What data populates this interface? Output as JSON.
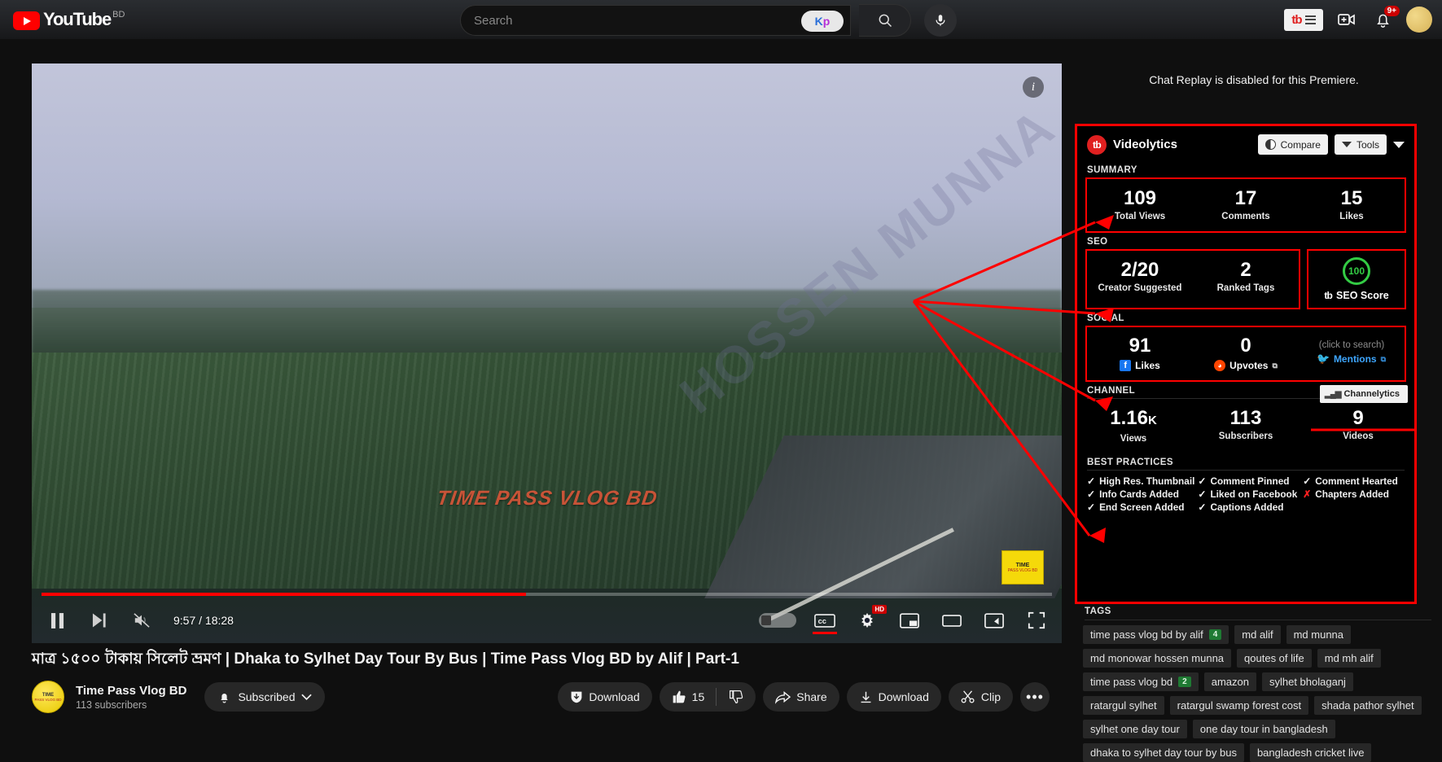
{
  "masthead": {
    "logo_text": "YouTube",
    "country_code": "BD",
    "search_placeholder": "Search",
    "search_value": "",
    "kp_badge_k": "K",
    "kp_badge_p": "p",
    "tubebuddy_label": "tb",
    "notification_count": "9+"
  },
  "player": {
    "current_time": "9:57",
    "duration": "18:28",
    "time_display": "9:57 / 18:28",
    "progress_percent": 47,
    "watermark_diagonal": "HOSSEN MUNNA",
    "watermark_center": "TIME PASS VLOG BD",
    "corner_logo_line1": "TIME",
    "corner_logo_line2": "PASS VLOG BD",
    "cc_label": "CC",
    "hd_badge": "HD",
    "info_glyph": "i"
  },
  "video": {
    "title": "মাত্র ১৫০০ টাকায় সিলেট ভ্রমণ | Dhaka to Sylhet Day Tour By Bus | Time Pass Vlog BD by Alif | Part-1",
    "channel_name": "Time Pass Vlog BD",
    "channel_subs": "113 subscribers",
    "avatar_line1": "TIME",
    "avatar_line2": "PASS VLOG BD",
    "subscribed_label": "Subscribed",
    "download_primary_label": "Download",
    "like_count": "15",
    "share_label": "Share",
    "download_label": "Download",
    "clip_label": "Clip",
    "more_label": "•••"
  },
  "chat": {
    "notice": "Chat Replay is disabled for this Premiere."
  },
  "videolytics": {
    "title": "Videolytics",
    "brand_mark": "tb",
    "compare_label": "Compare",
    "tools_label": "Tools",
    "sections": {
      "summary_label": "SUMMARY",
      "seo_label": "SEO",
      "social_label": "SOCIAL",
      "channel_label": "CHANNEL",
      "best_practices_label": "BEST PRACTICES",
      "tags_label": "TAGS"
    },
    "summary": [
      {
        "value": "109",
        "label": "Total Views"
      },
      {
        "value": "17",
        "label": "Comments"
      },
      {
        "value": "15",
        "label": "Likes"
      }
    ],
    "seo": [
      {
        "value": "2/20",
        "label": "Creator Suggested"
      },
      {
        "value": "2",
        "label": "Ranked Tags"
      }
    ],
    "seo_score": {
      "value": "100",
      "label": "SEO Score",
      "brand_mark": "tb",
      "ring_color": "#33cc44"
    },
    "social": [
      {
        "value": "91",
        "label": "Likes",
        "icon": "facebook-icon"
      },
      {
        "value": "0",
        "label": "Upvotes",
        "icon": "reddit-icon"
      },
      {
        "value": "(click to search)",
        "label": "Mentions",
        "icon": "twitter-icon"
      }
    ],
    "channelytics_tooltip": "Channelytics",
    "channel": [
      {
        "value": "1.16",
        "suffix": "K",
        "label": "Views"
      },
      {
        "value": "113",
        "suffix": "",
        "label": "Subscribers"
      },
      {
        "value": "9",
        "suffix": "",
        "label": "Videos"
      }
    ],
    "best_practices": [
      {
        "label": "High Res. Thumbnail",
        "done": true
      },
      {
        "label": "Comment Pinned",
        "done": true
      },
      {
        "label": "Comment Hearted",
        "done": true
      },
      {
        "label": "Info Cards Added",
        "done": true
      },
      {
        "label": "Liked on Facebook",
        "done": true
      },
      {
        "label": "Chapters Added",
        "done": false
      },
      {
        "label": "End Screen Added",
        "done": true
      },
      {
        "label": "Captions Added",
        "done": true
      }
    ],
    "tags": [
      {
        "label": "time pass vlog bd by alif",
        "rank": "4"
      },
      {
        "label": "md alif",
        "rank": ""
      },
      {
        "label": "md munna",
        "rank": ""
      },
      {
        "label": "md monowar hossen munna",
        "rank": ""
      },
      {
        "label": "qoutes of life",
        "rank": ""
      },
      {
        "label": "md mh alif",
        "rank": ""
      },
      {
        "label": "time pass vlog bd",
        "rank": "2"
      },
      {
        "label": "amazon",
        "rank": ""
      },
      {
        "label": "sylhet bholaganj",
        "rank": ""
      },
      {
        "label": "ratargul sylhet",
        "rank": ""
      },
      {
        "label": "ratargul swamp forest cost",
        "rank": ""
      },
      {
        "label": "shada pathor sylhet",
        "rank": ""
      },
      {
        "label": "sylhet one day tour",
        "rank": ""
      },
      {
        "label": "one day tour in bangladesh",
        "rank": ""
      },
      {
        "label": "dhaka to sylhet day tour by bus",
        "rank": ""
      },
      {
        "label": "bangladesh cricket live",
        "rank": ""
      }
    ]
  },
  "annotation": {
    "color": "#ff0000"
  }
}
